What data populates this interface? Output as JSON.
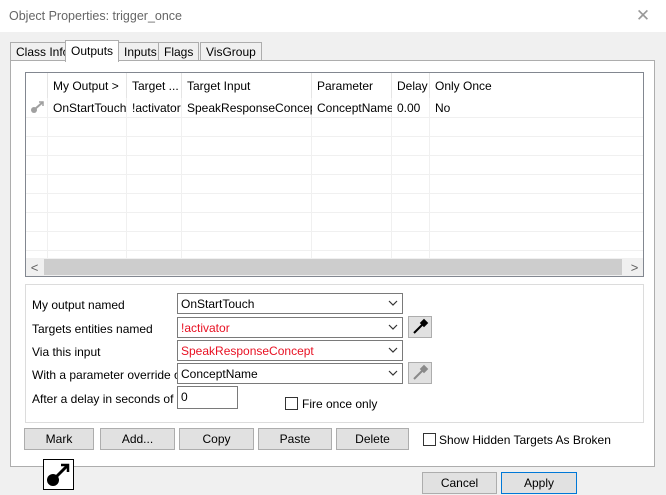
{
  "window": {
    "title": "Object Properties: trigger_once",
    "close_glyph": "✕"
  },
  "tabs": [
    {
      "label": "Class Info"
    },
    {
      "label": "Outputs"
    },
    {
      "label": "Inputs"
    },
    {
      "label": "Flags"
    },
    {
      "label": "VisGroup"
    }
  ],
  "active_tab": "Outputs",
  "outputs_list": {
    "columns": [
      "My Output  >",
      "Target ...",
      "Target Input",
      "Parameter",
      "Delay",
      "Only Once"
    ],
    "rows": [
      {
        "icon": "output-connection-icon",
        "cells": [
          "OnStartTouch",
          "!activator",
          "SpeakResponseConcept",
          "ConceptName",
          "0.00",
          "No"
        ]
      }
    ],
    "scroll_left_glyph": "<",
    "scroll_right_glyph": ">"
  },
  "fields": {
    "output_named": {
      "label": "My output named",
      "value": "OnStartTouch"
    },
    "targets_named": {
      "label": "Targets entities named",
      "value": "!activator"
    },
    "via_input": {
      "label": "Via this input",
      "value": "SpeakResponseConcept"
    },
    "parameter_override": {
      "label": "With a parameter override of",
      "value": "ConceptName"
    },
    "delay": {
      "label": "After a delay in seconds of",
      "value": "0"
    },
    "fire_once": {
      "label": "Fire once only",
      "checked": false
    }
  },
  "buttons": {
    "mark": "Mark",
    "add": "Add...",
    "copy": "Copy",
    "paste": "Paste",
    "delete": "Delete",
    "show_hidden": {
      "label": "Show Hidden Targets As Broken",
      "checked": false
    },
    "cancel": "Cancel",
    "apply": "Apply"
  },
  "colors": {
    "invalid_text": "#e81123",
    "default_button_border": "#0078d7"
  },
  "icons": {
    "entity_icon": "output-connection-icon",
    "eyedropper": "eyedropper-icon"
  }
}
